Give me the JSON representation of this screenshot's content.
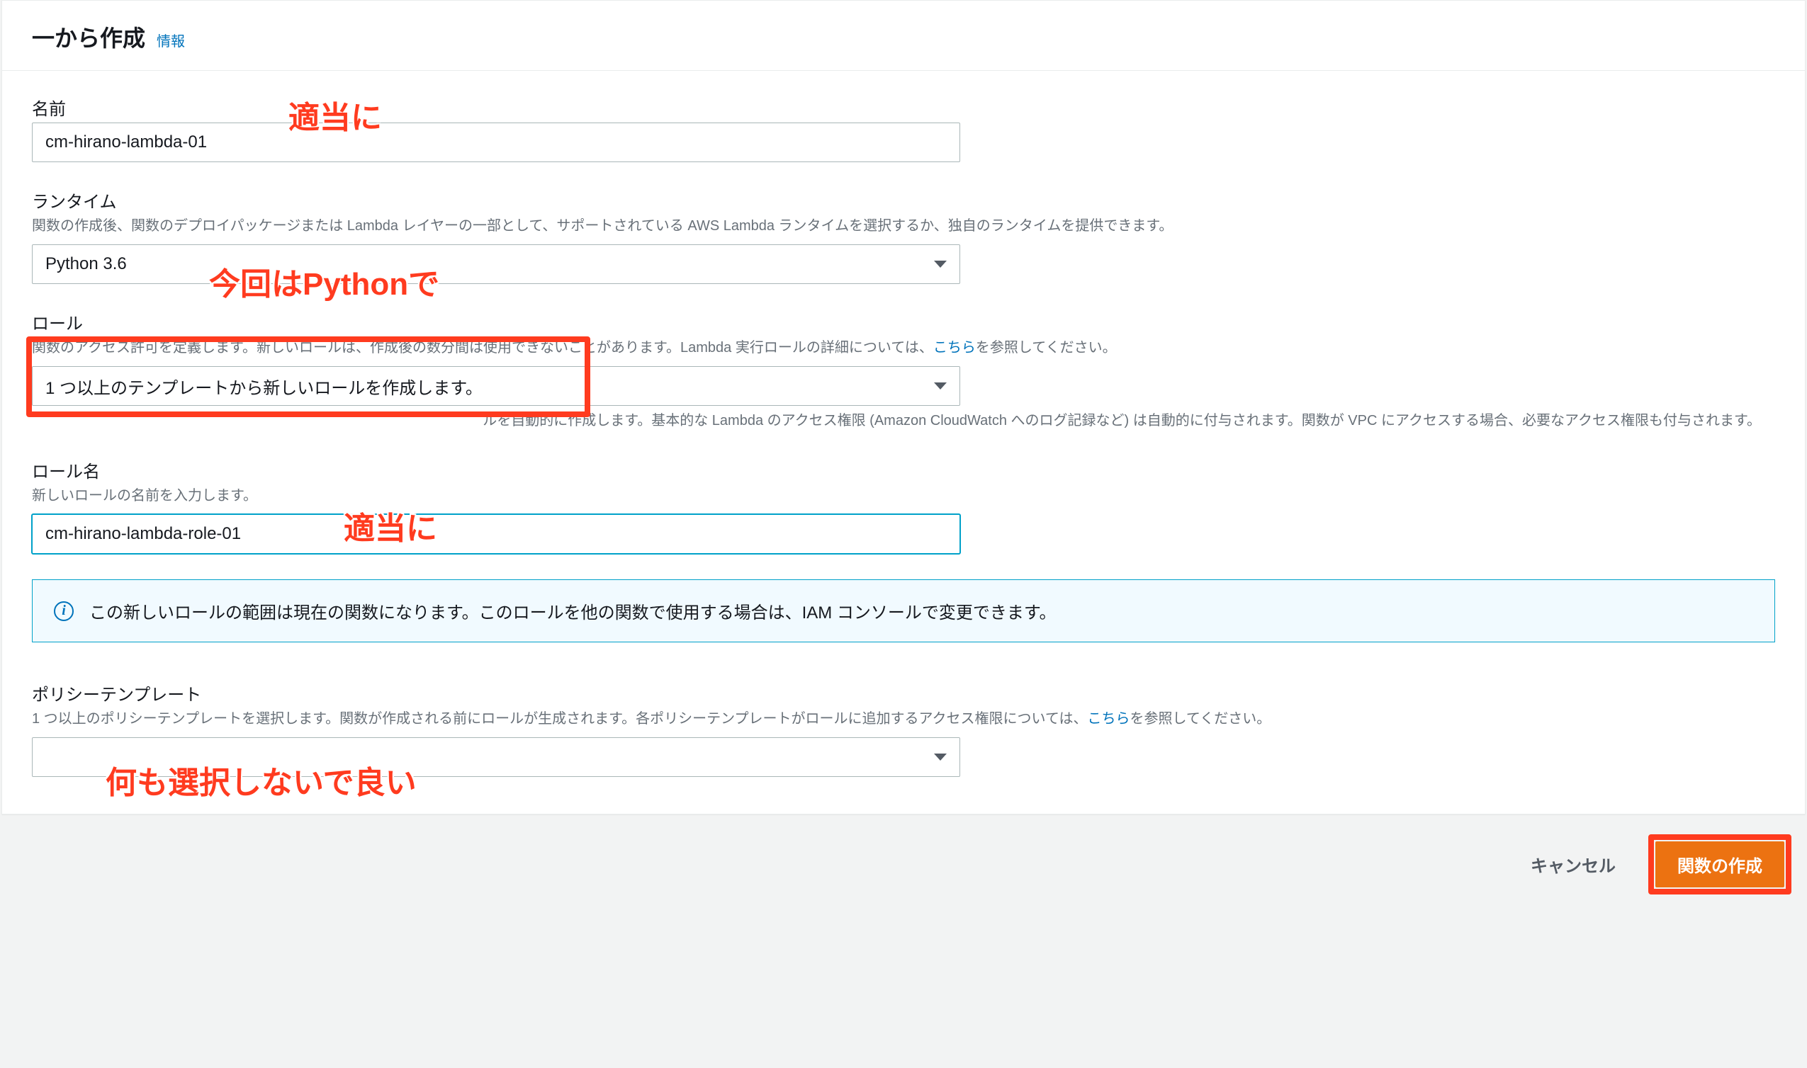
{
  "header": {
    "title": "一から作成",
    "info_label": "情報"
  },
  "name": {
    "label": "名前",
    "value": "cm-hirano-lambda-01"
  },
  "runtime": {
    "label": "ランタイム",
    "hint": "関数の作成後、関数のデプロイパッケージまたは Lambda レイヤーの一部として、サポートされている AWS Lambda ランタイムを選択するか、独自のランタイムを提供できます。",
    "selected": "Python 3.6"
  },
  "role": {
    "label": "ロール",
    "hint_pre": "関数のアクセス許可を定義します。新しいロールは、作成後の数分間は使用できないことがあります。Lambda 実行ロールの詳細については、",
    "hint_link": "こちら",
    "hint_post": "を参照してください。",
    "selected": "1 つ以上のテンプレートから新しいロールを作成します。",
    "after_hint": "ルを自動的に作成します。基本的な Lambda のアクセス権限 (Amazon CloudWatch へのログ記録など) は自動的に付与されます。関数が VPC にアクセスする場合、必要なアクセス権限も付与されます。"
  },
  "role_name": {
    "label": "ロール名",
    "hint": "新しいロールの名前を入力します。",
    "value": "cm-hirano-lambda-role-01"
  },
  "info_banner": {
    "message": "この新しいロールの範囲は現在の関数になります。このロールを他の関数で使用する場合は、IAM コンソールで変更できます。"
  },
  "policy": {
    "label": "ポリシーテンプレート",
    "hint_pre": "1 つ以上のポリシーテンプレートを選択します。関数が作成される前にロールが生成されます。各ポリシーテンプレートがロールに追加するアクセス権限については、",
    "hint_link": "こちら",
    "hint_post": "を参照してください。",
    "selected": ""
  },
  "footer": {
    "cancel": "キャンセル",
    "create": "関数の作成"
  },
  "annotations": {
    "a1": "適当に",
    "a2": "今回はPythonで",
    "a3": "適当に",
    "a4": "何も選択しないで良い"
  }
}
